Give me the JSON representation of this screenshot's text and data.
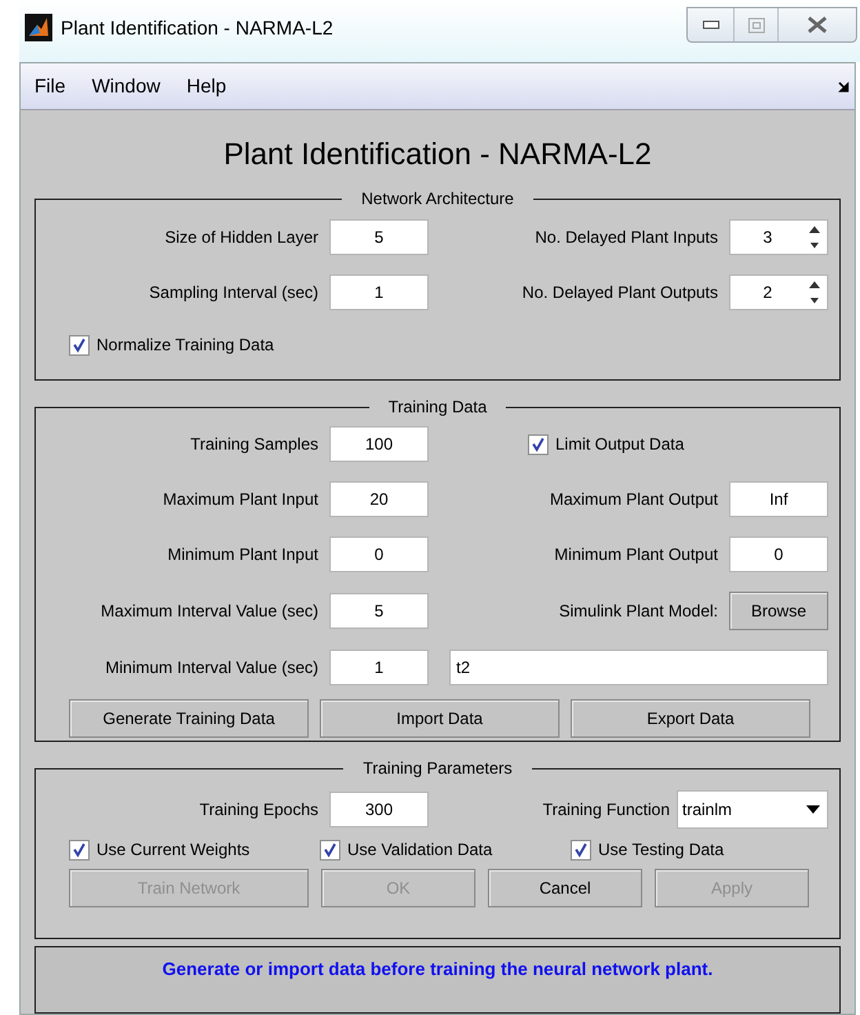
{
  "window": {
    "title": "Plant Identification - NARMA-L2"
  },
  "menu": [
    "File",
    "Window",
    "Help"
  ],
  "heading": "Plant Identification - NARMA-L2",
  "network_architecture": {
    "title": "Network Architecture",
    "left_fields": [
      {
        "label": "Size of Hidden Layer",
        "value": "5"
      },
      {
        "label": "Sampling Interval (sec)",
        "value": "1"
      }
    ],
    "right_fields": [
      {
        "label": "No. Delayed Plant Inputs",
        "value": "3"
      },
      {
        "label": "No. Delayed Plant Outputs",
        "value": "2"
      }
    ],
    "normalize": {
      "label": "Normalize Training Data",
      "checked": true
    }
  },
  "training_data": {
    "title": "Training Data",
    "left_fields": [
      {
        "label": "Training Samples",
        "value": "100"
      },
      {
        "label": "Maximum Plant Input",
        "value": "20"
      },
      {
        "label": "Minimum Plant Input",
        "value": "0"
      },
      {
        "label": "Maximum Interval Value (sec)",
        "value": "5"
      },
      {
        "label": "Minimum Interval Value (sec)",
        "value": "1"
      }
    ],
    "limit_output": {
      "label": "Limit Output Data",
      "checked": true
    },
    "right_fields": [
      {
        "label": "Maximum Plant Output",
        "value": "Inf"
      },
      {
        "label": "Minimum Plant Output",
        "value": "0"
      }
    ],
    "model": {
      "label": "Simulink Plant Model:",
      "button": "Browse",
      "path": "t2"
    },
    "buttons": [
      {
        "label": "Generate Training Data",
        "disabled": false
      },
      {
        "label": "Import Data",
        "disabled": false
      },
      {
        "label": "Export Data",
        "disabled": false
      }
    ]
  },
  "training_parameters": {
    "title": "Training Parameters",
    "epochs": {
      "label": "Training Epochs",
      "value": "300"
    },
    "function": {
      "label": "Training Function",
      "value": "trainlm"
    },
    "options": [
      {
        "label": "Use Current Weights",
        "checked": true
      },
      {
        "label": "Use Validation Data",
        "checked": true
      },
      {
        "label": "Use Testing Data",
        "checked": true
      }
    ],
    "buttons": [
      {
        "label": "Train Network",
        "disabled": true
      },
      {
        "label": "OK",
        "disabled": true
      },
      {
        "label": "Cancel",
        "disabled": false
      },
      {
        "label": "Apply",
        "disabled": true
      }
    ]
  },
  "status": "Generate or import data before training the neural network plant."
}
